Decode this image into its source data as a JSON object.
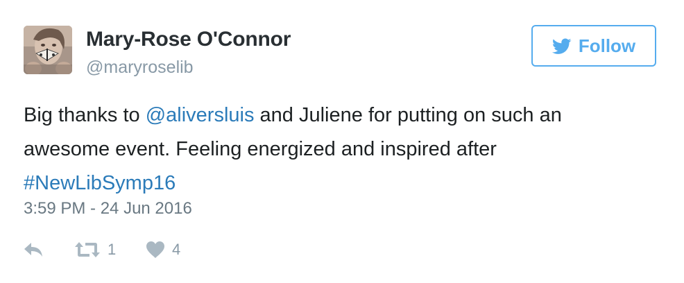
{
  "user": {
    "display_name": "Mary-Rose O'Connor",
    "screen_name": "@maryroselib",
    "avatar_icon": "profile-photo-butterfly"
  },
  "follow_button": {
    "label": "Follow",
    "icon": "twitter-bird-icon",
    "color": "#55acee"
  },
  "tweet": {
    "text_before_mention": "Big thanks to ",
    "mention": "@aliversluis",
    "text_after_mention": " and Juliene for putting on such an awesome event. Feeling energized and inspired after ",
    "hashtag": "#NewLibSymp16",
    "link_color": "#2b7bb9"
  },
  "timestamp": "3:59 PM - 24 Jun 2016",
  "actions": {
    "reply": {
      "icon": "reply-icon"
    },
    "retweet": {
      "icon": "retweet-icon",
      "count": "1"
    },
    "like": {
      "icon": "heart-icon",
      "count": "4"
    }
  }
}
